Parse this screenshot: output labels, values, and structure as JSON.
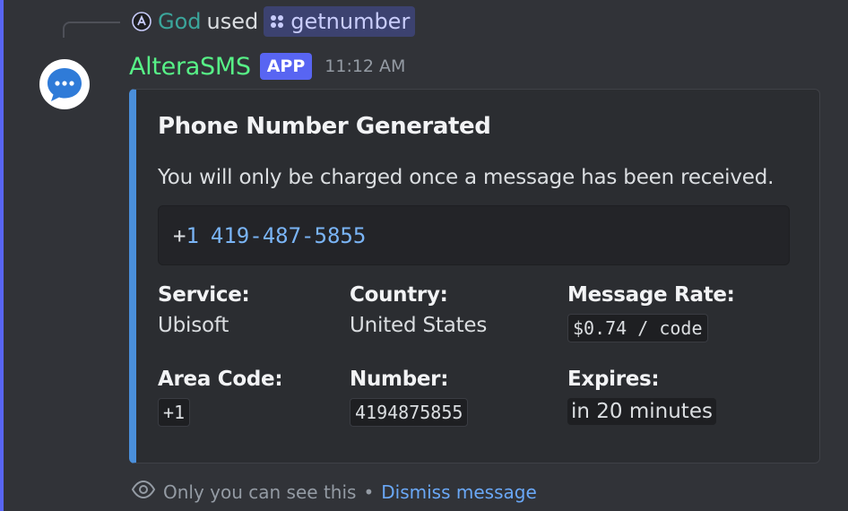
{
  "interaction": {
    "user": "God",
    "used_text": "used",
    "command": "getnumber"
  },
  "message": {
    "bot_name": "AlteraSMS",
    "tag": "APP",
    "timestamp": "11:12 AM"
  },
  "embed": {
    "accent_color": "#4a8fdb",
    "title": "Phone Number Generated",
    "description": "You will only be charged once a message has been received.",
    "phone_prefix": "+1",
    "phone_number": "419-487-5855",
    "fields": {
      "service": {
        "name": "Service:",
        "value": "Ubisoft"
      },
      "country": {
        "name": "Country:",
        "value": "United States"
      },
      "message_rate": {
        "name": "Message Rate:",
        "value": "$0.74 / code"
      },
      "area_code": {
        "name": "Area Code:",
        "value": "+1"
      },
      "number": {
        "name": "Number:",
        "value": "4194875855"
      },
      "expires": {
        "name": "Expires:",
        "value": "in 20 minutes"
      }
    }
  },
  "ephemeral": {
    "notice": "Only you can see this",
    "separator": "•",
    "dismiss": "Dismiss message"
  }
}
